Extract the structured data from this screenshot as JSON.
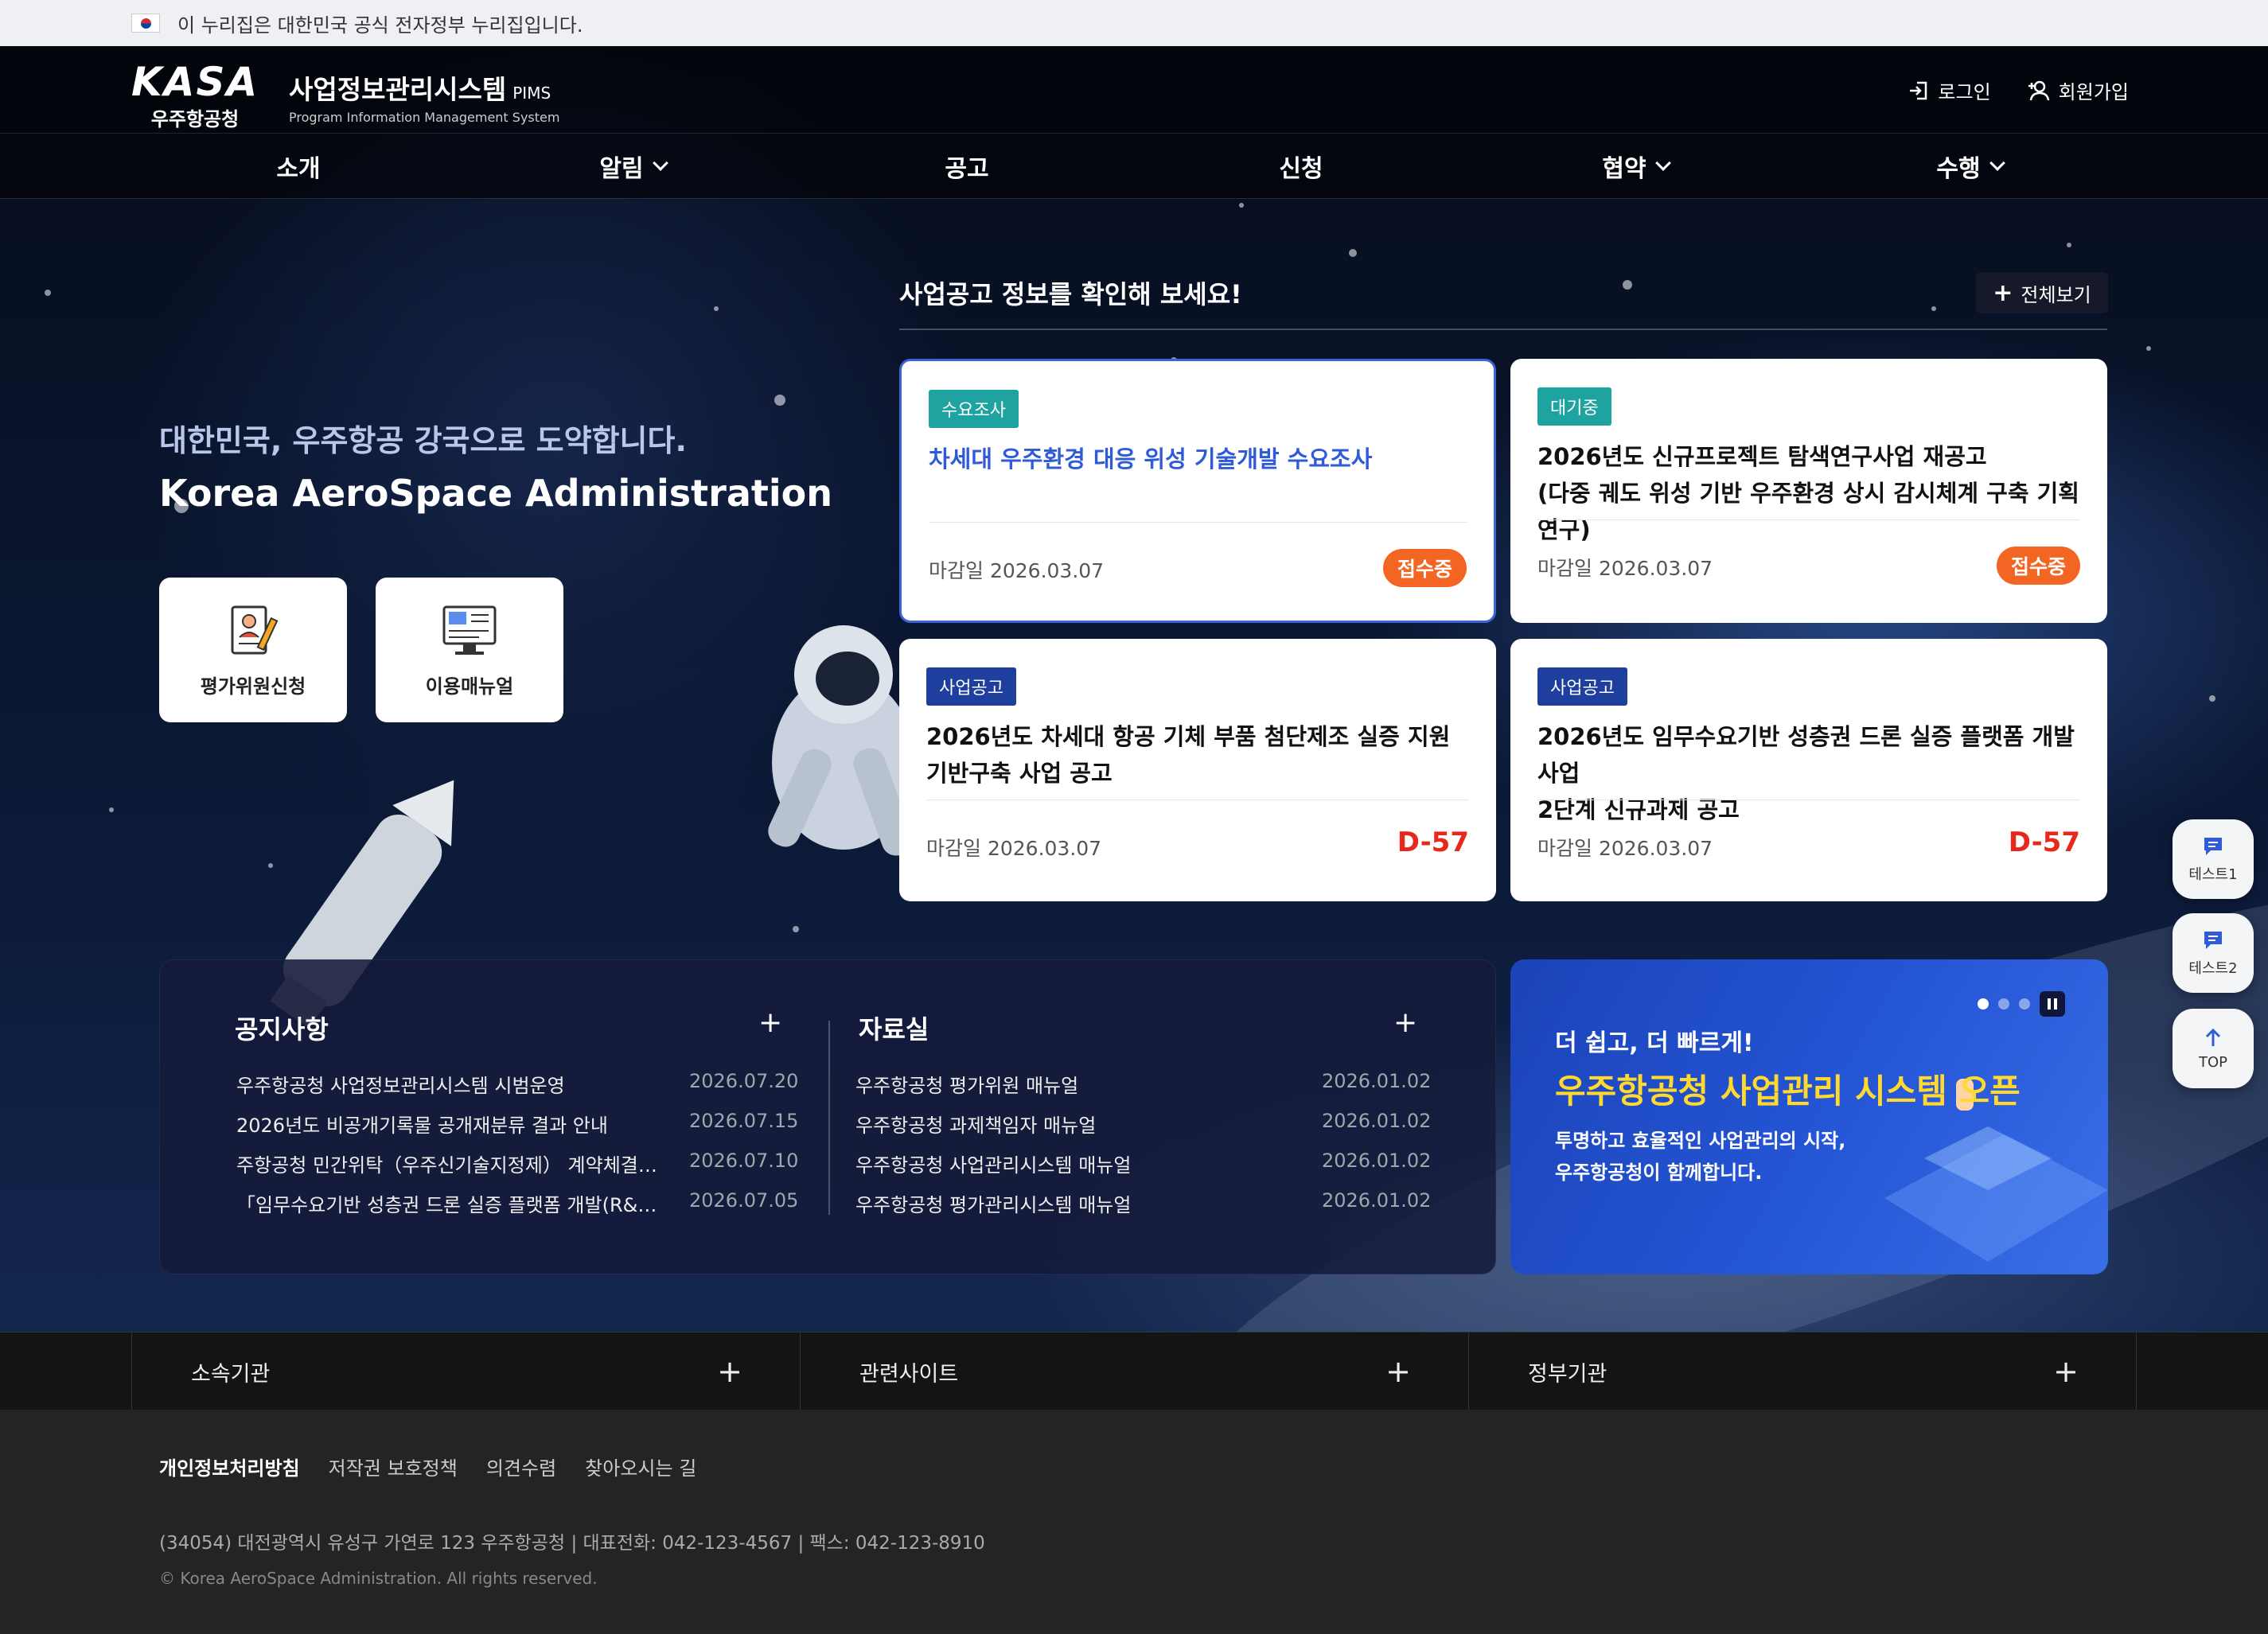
{
  "gov_banner": "이 누리집은 대한민국 공식 전자정부 누리집입니다.",
  "logo": {
    "mark": "KASA",
    "sub": "우주항공청"
  },
  "system": {
    "title": "사업정보관리시스템",
    "suffix": "PIMS",
    "subtitle": "Program Information Management System"
  },
  "auth": {
    "login": "로그인",
    "signup": "회원가입"
  },
  "nav": [
    {
      "label": "소개"
    },
    {
      "label": "알림"
    },
    {
      "label": "공고"
    },
    {
      "label": "신청"
    },
    {
      "label": "협약"
    },
    {
      "label": "수행"
    }
  ],
  "hero": {
    "slogan_ko": "대한민국, 우주항공 강국으로 도약합니다.",
    "slogan_en": "Korea AeroSpace Administration"
  },
  "quick": [
    {
      "label": "평가위원신청",
      "icon": "evaluator-icon"
    },
    {
      "label": "이용매뉴얼",
      "icon": "manual-icon"
    }
  ],
  "announcements": {
    "heading": "사업공고 정보를 확인해 보세요!",
    "view_all": "전체보기",
    "cards": [
      {
        "tag": "수요조사",
        "tag_color": "#1fa3a0",
        "title_l1": "차세대 우주환경 대응 위성 기술개발 수요조사",
        "title_l2": "",
        "deadline": "마감일 2026.03.07",
        "status": "접수중"
      },
      {
        "tag": "대기중",
        "tag_color": "#1fa3a0",
        "title_l1": "2026년도 신규프로젝트 탐색연구사업 재공고",
        "title_l2": "(다중 궤도 위성 기반 우주환경 상시 감시체계 구축 기획연구)",
        "deadline": "마감일 2026.03.07",
        "status": "접수중"
      },
      {
        "tag": "사업공고",
        "tag_color": "#1f3f9e",
        "title_l1": "2026년도 차세대 항공 기체 부품 첨단제조 실증 지원",
        "title_l2": "기반구축 사업 공고",
        "deadline": "마감일 2026.03.07",
        "status": "D-57"
      },
      {
        "tag": "사업공고",
        "tag_color": "#1f3f9e",
        "title_l1": "2026년도 임무수요기반 성층권 드론 실증 플랫폼 개발 사업",
        "title_l2": "2단계 신규과제 공고",
        "deadline": "마감일 2026.03.07",
        "status": "D-57"
      }
    ]
  },
  "notice": {
    "title": "공지사항",
    "items": [
      {
        "text": "우주항공청 사업정보관리시스템 시범운영",
        "date": "2026.07.20"
      },
      {
        "text": "2026년도 비공개기록물 공개재분류 결과 안내",
        "date": "2026.07.15"
      },
      {
        "text": "주항공청 민간위탁（우주신기술지정제） 계약체결사항 공개",
        "date": "2026.07.10"
      },
      {
        "text": "「임무수요기반 성층권 드론 실증 플랫폼 개발(R&D)」 공고",
        "date": "2026.07.05"
      }
    ]
  },
  "archive": {
    "title": "자료실",
    "items": [
      {
        "text": "우주항공청 평가위원 매뉴얼",
        "date": "2026.01.02"
      },
      {
        "text": "우주항공청 과제책임자 매뉴얼",
        "date": "2026.01.02"
      },
      {
        "text": "우주항공청 사업관리시스템 매뉴얼",
        "date": "2026.01.02"
      },
      {
        "text": "우주항공청 평가관리시스템 매뉴얼",
        "date": "2026.01.02"
      }
    ]
  },
  "banner": {
    "line1": "더 쉽고, 더 빠르게!",
    "line2": "우주항공청 사업관리 시스템 오픈",
    "line3": "투명하고 효율적인 사업관리의 시작,",
    "line4": "우주항공청이 함께합니다."
  },
  "floating": [
    {
      "label": "테스트1"
    },
    {
      "label": "테스트2"
    },
    {
      "label": "TOP"
    }
  ],
  "related": [
    {
      "label": "소속기관"
    },
    {
      "label": "관련사이트"
    },
    {
      "label": "정부기관"
    }
  ],
  "footer": {
    "menu": [
      {
        "label": "개인정보처리방침"
      },
      {
        "label": "저작권 보호정책"
      },
      {
        "label": "의견수렴"
      },
      {
        "label": "찾아오시는 길"
      }
    ],
    "address": "(34054) 대전광역시 유성구 가연로 123 우주항공청  |  대표전화: 042-123-4567  |  팩스: 042-123-8910",
    "copyright": "© Korea AeroSpace Administration. All rights reserved."
  },
  "colors": {
    "accent_blue": "#2f5bd8",
    "status_orange": "#f26522",
    "dday_red": "#e8281c",
    "banner_yellow": "#ffd92e"
  }
}
